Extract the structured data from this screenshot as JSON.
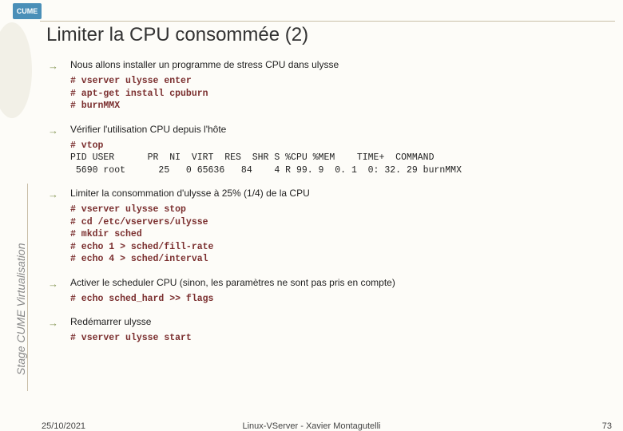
{
  "logo": "CUME",
  "title": "Limiter la CPU consommée (2)",
  "sidebar": "Stage CUME Virtualisation",
  "bullets": [
    {
      "text": "Nous allons installer un programme de stress CPU dans ulysse"
    },
    {
      "text": "Vérifier l'utilisation CPU depuis l'hôte"
    },
    {
      "text": "Limiter la consommation d'ulysse à 25% (1/4) de la CPU"
    },
    {
      "text": "Activer le scheduler CPU (sinon, les paramètres ne sont pas pris en compte)"
    },
    {
      "text": "Redémarrer ulysse"
    }
  ],
  "code": {
    "install": "# vserver ulysse enter\n# apt-get install cpuburn\n# burnMMX",
    "vtop_cmd": "# vtop",
    "vtop_out": "PID USER      PR  NI  VIRT  RES  SHR S %CPU %MEM    TIME+  COMMAND\n 5690 root      25   0 65636   84    4 R 99. 9  0. 1  0: 32. 29 burnMMX",
    "sched": "# vserver ulysse stop\n# cd /etc/vservers/ulysse\n# mkdir sched\n# echo 1 > sched/fill-rate\n# echo 4 > sched/interval",
    "flags": "# echo sched_hard >> flags",
    "start": "# vserver ulysse start"
  },
  "footer": {
    "date": "25/10/2021",
    "center": "Linux-VServer - Xavier Montagutelli",
    "page": "73"
  }
}
